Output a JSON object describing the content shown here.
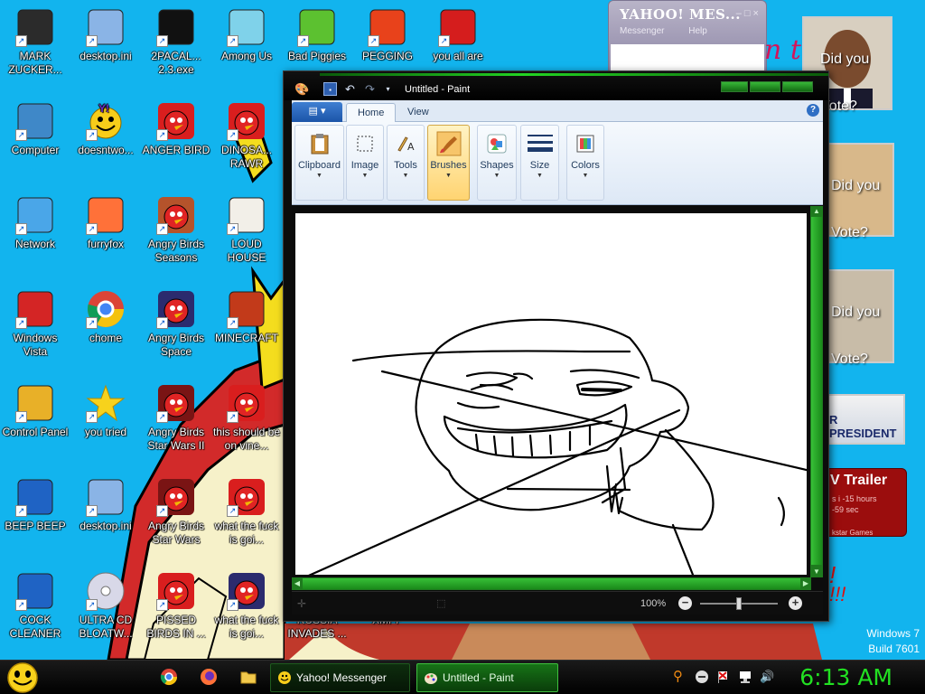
{
  "desktop": {
    "icons": [
      {
        "label": "MARK ZUCKER...",
        "icon": "person-icon"
      },
      {
        "label": "desktop.ini",
        "icon": "ini-file-icon"
      },
      {
        "label": "2PACAL... 2.3.exe",
        "icon": "console-exe-icon"
      },
      {
        "label": "Among Us",
        "icon": "among-us-icon"
      },
      {
        "label": "Bad Piggies",
        "icon": "bad-piggies-icon"
      },
      {
        "label": "PEGGING",
        "icon": "pegging-icon"
      },
      {
        "label": "you all are",
        "icon": "dev-cpp-icon"
      },
      {
        "label": "Computer",
        "icon": "computer-icon"
      },
      {
        "label": "doesntwo...",
        "icon": "yahoo-icon"
      },
      {
        "label": "ANGER BIRD",
        "icon": "angry-bird-icon"
      },
      {
        "label": "DINOSA... RAWR",
        "icon": "angry-bird-icon"
      },
      {
        "label": "Network",
        "icon": "network-icon"
      },
      {
        "label": "furryfox",
        "icon": "firefox-icon"
      },
      {
        "label": "Angry Birds Seasons",
        "icon": "angry-birds-seasons-icon"
      },
      {
        "label": "LOUD HOUSE",
        "icon": "loud-house-icon"
      },
      {
        "label": "Windows Vista",
        "icon": "recycle-bin-icon"
      },
      {
        "label": "chome",
        "icon": "chrome-icon"
      },
      {
        "label": "Angry Birds Space",
        "icon": "angry-birds-space-icon"
      },
      {
        "label": "MINECRAFT",
        "icon": "minecraft-icon"
      },
      {
        "label": "Control Panel",
        "icon": "control-panel-icon"
      },
      {
        "label": "you tried",
        "icon": "star-icon"
      },
      {
        "label": "Angry Birds Star Wars II",
        "icon": "angry-birds-star-wars-icon"
      },
      {
        "label": "this should be on vine...",
        "icon": "angry-bird-icon"
      },
      {
        "label": "BEEP BEEP",
        "icon": "blue-file-icon"
      },
      {
        "label": "desktop.ini",
        "icon": "ini-file-icon"
      },
      {
        "label": "Angry Birds Star Wars",
        "icon": "angry-birds-star-wars-icon"
      },
      {
        "label": "what the fuck is goi...",
        "icon": "angry-bird-icon"
      },
      {
        "label": "COCK CLEANER",
        "icon": "blue-file-icon"
      },
      {
        "label": "ULTRA CD BLOATW...",
        "icon": "cd-icon"
      },
      {
        "label": "PISSED BIRDS IN ...",
        "icon": "angry-bird-icon"
      },
      {
        "label": "what the fuck is goi...",
        "icon": "angry-birds-space-icon"
      },
      {
        "label": "RUSSIA INVADES ...",
        "icon": "none"
      },
      {
        "label": "XMPP",
        "icon": "none"
      }
    ]
  },
  "yahoo_window": {
    "title": "YAHOO! MES...",
    "menu": [
      "Messenger",
      "Help"
    ]
  },
  "ads": {
    "vote_text": "Did you Vote?",
    "president_text": "R PRESIDENT",
    "trailer_title": "V Trailer",
    "trailer_line1": "s i -15 hours",
    "trailer_line2": "-59 sec",
    "trailer_line3": "kstar Games"
  },
  "paint": {
    "title": "Untitled - Paint",
    "tabs": [
      "Home",
      "View"
    ],
    "active_tab": "Home",
    "groups": [
      {
        "label": "Clipboard",
        "icon": "clipboard-icon"
      },
      {
        "label": "Image",
        "icon": "image-select-icon"
      },
      {
        "label": "Tools",
        "icon": "tools-icon"
      },
      {
        "label": "Brushes",
        "icon": "brush-icon",
        "selected": true
      },
      {
        "label": "Shapes",
        "icon": "shapes-icon"
      },
      {
        "label": "Size",
        "icon": "size-icon"
      },
      {
        "label": "Colors",
        "icon": "colors-icon"
      }
    ],
    "zoom": "100%"
  },
  "watermark": {
    "line1": "Windows 7",
    "line2": "Build 7601"
  },
  "taskbar": {
    "buttons": [
      {
        "label": "Yahoo! Messenger",
        "icon": "yahoo-icon",
        "active": false
      },
      {
        "label": "Untitled - Paint",
        "icon": "paint-icon",
        "active": true
      }
    ],
    "pinned": [
      "chrome-icon",
      "firefox-icon",
      "folder-icon"
    ],
    "tray": [
      "search-icon",
      "minus-icon",
      "flag-icon",
      "network-icon",
      "speaker-icon"
    ],
    "clock": "6:13 AM"
  }
}
